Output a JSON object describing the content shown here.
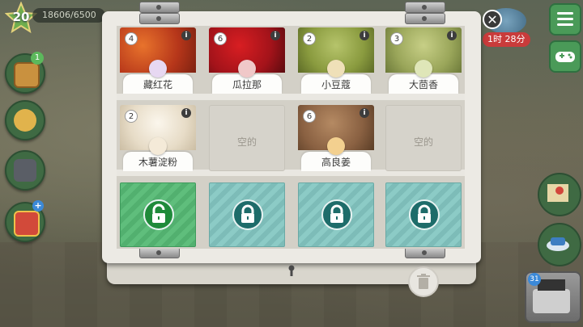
{
  "player": {
    "level": "20",
    "xp": "18606/6500"
  },
  "badges": {
    "book": "1",
    "gift": "+",
    "register": "31"
  },
  "event": {
    "timer": "1时 28分"
  },
  "chest": {
    "close_symbol": "✕",
    "slots": [
      {
        "name": "藏红花",
        "count": "4",
        "empty": false,
        "photo": "saffron"
      },
      {
        "name": "瓜拉那",
        "count": "6",
        "empty": false,
        "photo": "guarana"
      },
      {
        "name": "小豆蔻",
        "count": "2",
        "empty": false,
        "photo": "cardamom"
      },
      {
        "name": "大茴香",
        "count": "3",
        "empty": false,
        "photo": "anise"
      },
      {
        "name": "木薯淀粉",
        "count": "2",
        "empty": false,
        "photo": "tapioca"
      },
      {
        "name": "空的",
        "count": "",
        "empty": true
      },
      {
        "name": "高良姜",
        "count": "6",
        "empty": false,
        "photo": "galangal"
      },
      {
        "name": "空的",
        "count": "",
        "empty": true
      }
    ],
    "locked_slots": [
      {
        "state": "unlockable",
        "color": "green"
      },
      {
        "state": "locked",
        "color": "teal"
      },
      {
        "state": "locked",
        "color": "teal"
      },
      {
        "state": "locked",
        "color": "teal"
      }
    ]
  }
}
